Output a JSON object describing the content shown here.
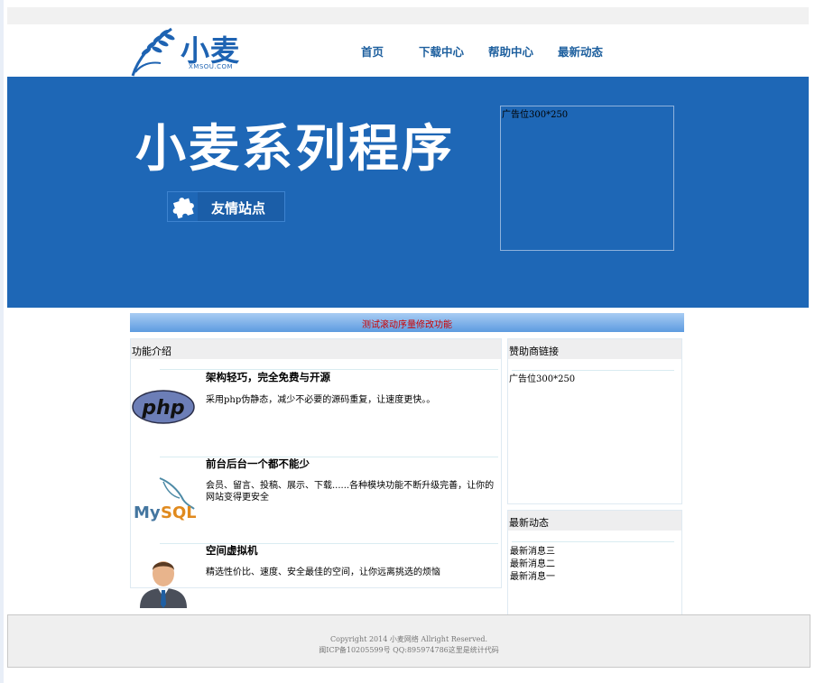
{
  "header": {
    "logo_text": "小麦",
    "logo_sub": "XMSOU.COM",
    "nav": [
      "首页",
      "下载中心",
      "帮助中心",
      "最新动态"
    ]
  },
  "banner": {
    "title": "小麦系列程序",
    "friends_button": "友情站点",
    "ad_label": "广告位300*250"
  },
  "marquee": "测试滚动序量修改功能",
  "features": {
    "heading": "功能介绍",
    "items": [
      {
        "title": "架构轻巧，完全免费与开源",
        "desc": "采用php伪静态，减少不必要的源码重复，让速度更快。。",
        "icon": "php-logo-icon"
      },
      {
        "title": "前台后台一个都不能少",
        "desc": "会员、留言、投稿、展示、下载......各种模块功能不断升级完善，让你的网站变得更安全",
        "icon": "mysql-logo-icon"
      },
      {
        "title": "空间虚拟机",
        "desc": "精选性价比、速度、安全最佳的空间，让你远离挑选的烦恼",
        "icon": "businessman-avatar-icon"
      }
    ]
  },
  "sponsor": {
    "heading": "赞助商链接",
    "ad_label": "广告位300*250"
  },
  "news": {
    "heading": "最新动态",
    "items": [
      "最新消息三",
      "最新消息二",
      "最新消息一"
    ]
  },
  "footer": {
    "copyright": "Copyright 2014 小麦网络   Allright Reserved.",
    "icp": "闽ICP备10205599号  QQ:895974786这里是统计代码"
  },
  "colors": {
    "brand_blue": "#1e67b6",
    "nav_text": "#1d5f9e",
    "marquee_text": "#cc0000"
  }
}
